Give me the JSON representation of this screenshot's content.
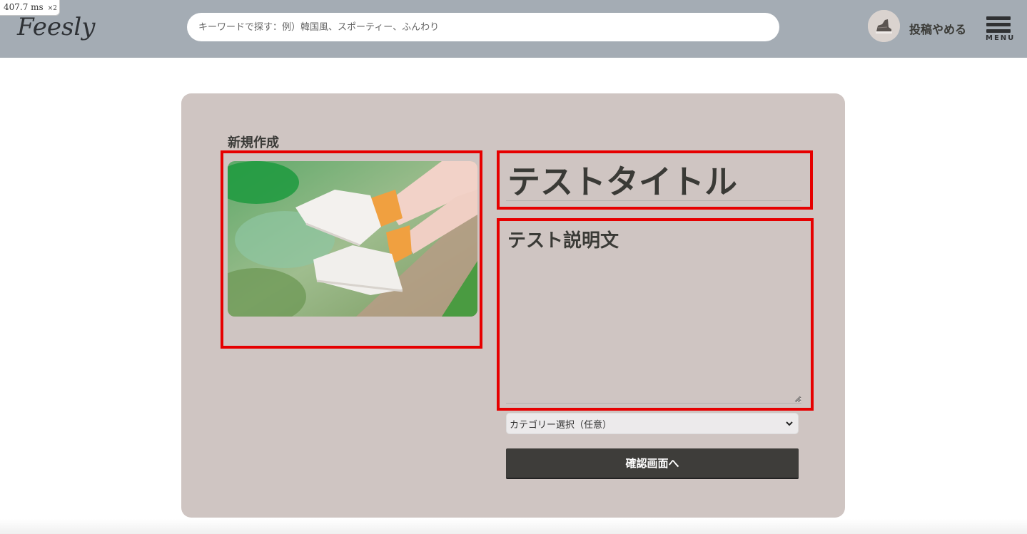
{
  "perf": {
    "time": "407.7 ms",
    "multiplier": "×2"
  },
  "header": {
    "logo": "Feesly",
    "search_placeholder": "キーワードで探す：例）韓国風、スポーティー、ふんわり",
    "quit_label": "投稿やめる",
    "menu_label": "MENU"
  },
  "form": {
    "heading": "新規作成",
    "title_value": "テストタイトル",
    "description_value": "テスト説明文",
    "category_selected": "カテゴリー選択（任意）",
    "confirm_label": "確認画面へ"
  },
  "colors": {
    "header_bg": "#a4acb4",
    "card_bg": "#cfc5c2",
    "highlight": "#e60000",
    "button_bg": "#3e3d3a"
  },
  "icons": {
    "avatar": "sneaker-avatar-icon",
    "menu": "hamburger-icon",
    "select": "chevron-down-icon"
  }
}
